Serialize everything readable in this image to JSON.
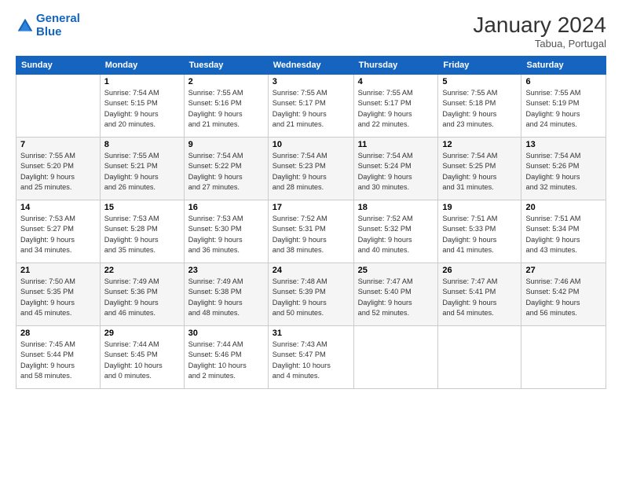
{
  "logo": {
    "line1": "General",
    "line2": "Blue"
  },
  "title": "January 2024",
  "location": "Tabua, Portugal",
  "headers": [
    "Sunday",
    "Monday",
    "Tuesday",
    "Wednesday",
    "Thursday",
    "Friday",
    "Saturday"
  ],
  "weeks": [
    [
      {
        "day": "",
        "info": ""
      },
      {
        "day": "1",
        "info": "Sunrise: 7:54 AM\nSunset: 5:15 PM\nDaylight: 9 hours\nand 20 minutes."
      },
      {
        "day": "2",
        "info": "Sunrise: 7:55 AM\nSunset: 5:16 PM\nDaylight: 9 hours\nand 21 minutes."
      },
      {
        "day": "3",
        "info": "Sunrise: 7:55 AM\nSunset: 5:17 PM\nDaylight: 9 hours\nand 21 minutes."
      },
      {
        "day": "4",
        "info": "Sunrise: 7:55 AM\nSunset: 5:17 PM\nDaylight: 9 hours\nand 22 minutes."
      },
      {
        "day": "5",
        "info": "Sunrise: 7:55 AM\nSunset: 5:18 PM\nDaylight: 9 hours\nand 23 minutes."
      },
      {
        "day": "6",
        "info": "Sunrise: 7:55 AM\nSunset: 5:19 PM\nDaylight: 9 hours\nand 24 minutes."
      }
    ],
    [
      {
        "day": "7",
        "info": "Sunrise: 7:55 AM\nSunset: 5:20 PM\nDaylight: 9 hours\nand 25 minutes."
      },
      {
        "day": "8",
        "info": "Sunrise: 7:55 AM\nSunset: 5:21 PM\nDaylight: 9 hours\nand 26 minutes."
      },
      {
        "day": "9",
        "info": "Sunrise: 7:54 AM\nSunset: 5:22 PM\nDaylight: 9 hours\nand 27 minutes."
      },
      {
        "day": "10",
        "info": "Sunrise: 7:54 AM\nSunset: 5:23 PM\nDaylight: 9 hours\nand 28 minutes."
      },
      {
        "day": "11",
        "info": "Sunrise: 7:54 AM\nSunset: 5:24 PM\nDaylight: 9 hours\nand 30 minutes."
      },
      {
        "day": "12",
        "info": "Sunrise: 7:54 AM\nSunset: 5:25 PM\nDaylight: 9 hours\nand 31 minutes."
      },
      {
        "day": "13",
        "info": "Sunrise: 7:54 AM\nSunset: 5:26 PM\nDaylight: 9 hours\nand 32 minutes."
      }
    ],
    [
      {
        "day": "14",
        "info": "Sunrise: 7:53 AM\nSunset: 5:27 PM\nDaylight: 9 hours\nand 34 minutes."
      },
      {
        "day": "15",
        "info": "Sunrise: 7:53 AM\nSunset: 5:28 PM\nDaylight: 9 hours\nand 35 minutes."
      },
      {
        "day": "16",
        "info": "Sunrise: 7:53 AM\nSunset: 5:30 PM\nDaylight: 9 hours\nand 36 minutes."
      },
      {
        "day": "17",
        "info": "Sunrise: 7:52 AM\nSunset: 5:31 PM\nDaylight: 9 hours\nand 38 minutes."
      },
      {
        "day": "18",
        "info": "Sunrise: 7:52 AM\nSunset: 5:32 PM\nDaylight: 9 hours\nand 40 minutes."
      },
      {
        "day": "19",
        "info": "Sunrise: 7:51 AM\nSunset: 5:33 PM\nDaylight: 9 hours\nand 41 minutes."
      },
      {
        "day": "20",
        "info": "Sunrise: 7:51 AM\nSunset: 5:34 PM\nDaylight: 9 hours\nand 43 minutes."
      }
    ],
    [
      {
        "day": "21",
        "info": "Sunrise: 7:50 AM\nSunset: 5:35 PM\nDaylight: 9 hours\nand 45 minutes."
      },
      {
        "day": "22",
        "info": "Sunrise: 7:49 AM\nSunset: 5:36 PM\nDaylight: 9 hours\nand 46 minutes."
      },
      {
        "day": "23",
        "info": "Sunrise: 7:49 AM\nSunset: 5:38 PM\nDaylight: 9 hours\nand 48 minutes."
      },
      {
        "day": "24",
        "info": "Sunrise: 7:48 AM\nSunset: 5:39 PM\nDaylight: 9 hours\nand 50 minutes."
      },
      {
        "day": "25",
        "info": "Sunrise: 7:47 AM\nSunset: 5:40 PM\nDaylight: 9 hours\nand 52 minutes."
      },
      {
        "day": "26",
        "info": "Sunrise: 7:47 AM\nSunset: 5:41 PM\nDaylight: 9 hours\nand 54 minutes."
      },
      {
        "day": "27",
        "info": "Sunrise: 7:46 AM\nSunset: 5:42 PM\nDaylight: 9 hours\nand 56 minutes."
      }
    ],
    [
      {
        "day": "28",
        "info": "Sunrise: 7:45 AM\nSunset: 5:44 PM\nDaylight: 9 hours\nand 58 minutes."
      },
      {
        "day": "29",
        "info": "Sunrise: 7:44 AM\nSunset: 5:45 PM\nDaylight: 10 hours\nand 0 minutes."
      },
      {
        "day": "30",
        "info": "Sunrise: 7:44 AM\nSunset: 5:46 PM\nDaylight: 10 hours\nand 2 minutes."
      },
      {
        "day": "31",
        "info": "Sunrise: 7:43 AM\nSunset: 5:47 PM\nDaylight: 10 hours\nand 4 minutes."
      },
      {
        "day": "",
        "info": ""
      },
      {
        "day": "",
        "info": ""
      },
      {
        "day": "",
        "info": ""
      }
    ]
  ]
}
